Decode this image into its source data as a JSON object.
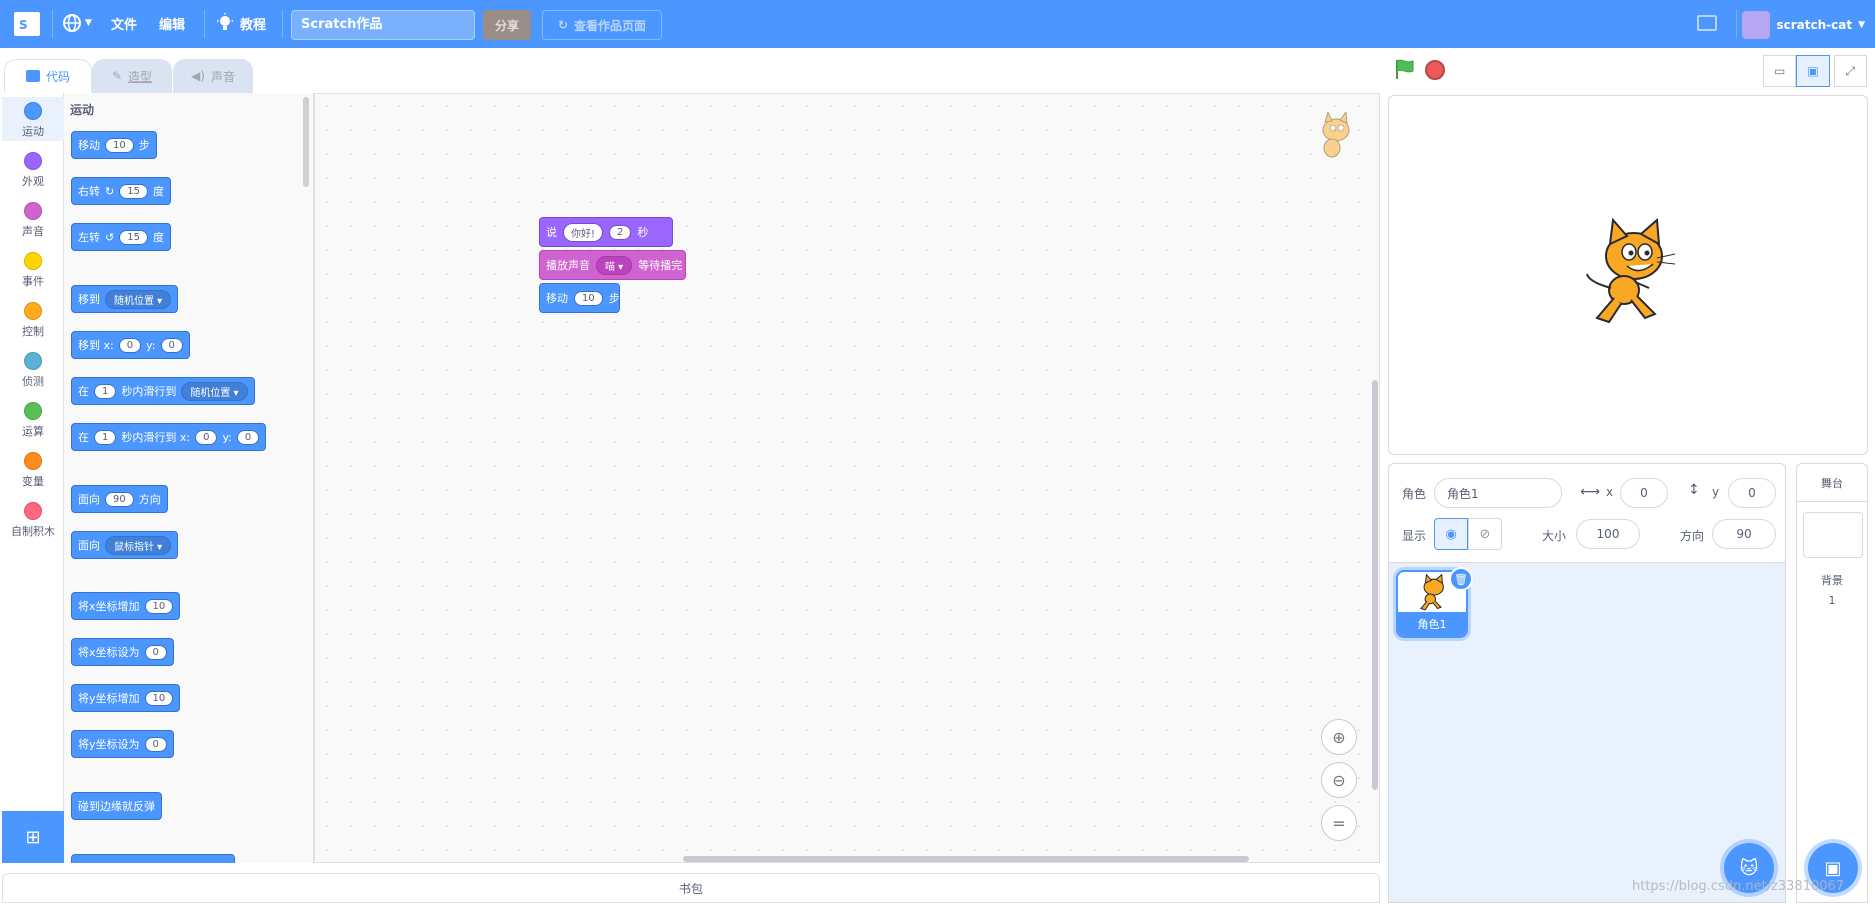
{
  "topbar": {
    "menu_file": "文件",
    "menu_edit": "编辑",
    "tutorials": "教程",
    "project_title": "Scratch作品",
    "share": "分享",
    "see_project_page": "查看作品页面",
    "username": "scratch-cat",
    "logo_icon": "scratch-logo-icon",
    "accent_color": "#4c97ff"
  },
  "tabs": [
    {
      "label": "代码",
      "icon": "code-icon"
    },
    {
      "label": "造型",
      "icon": "brush-icon"
    },
    {
      "label": "声音",
      "icon": "speaker-icon"
    }
  ],
  "categories": [
    {
      "label": "运动",
      "color": "#4c97ff"
    },
    {
      "label": "外观",
      "color": "#9966ff"
    },
    {
      "label": "声音",
      "color": "#cf63cf"
    },
    {
      "label": "事件",
      "color": "#ffd500"
    },
    {
      "label": "控制",
      "color": "#ffab19"
    },
    {
      "label": "侦测",
      "color": "#5cb1d6"
    },
    {
      "label": "运算",
      "color": "#59c059"
    },
    {
      "label": "变量",
      "color": "#ff8c1a"
    },
    {
      "label": "自制积木",
      "color": "#ff6680"
    }
  ],
  "flyout": {
    "title": "运动",
    "move": {
      "a": "移动",
      "v": "10",
      "b": "步"
    },
    "turn_right": {
      "a": "右转",
      "v": "15",
      "b": "度"
    },
    "turn_left": {
      "a": "左转",
      "v": "15",
      "b": "度"
    },
    "goto": {
      "a": "移到",
      "dd": "随机位置"
    },
    "goto_xy": {
      "a": "移到 x:",
      "x": "0",
      "y_label": "y:",
      "y": "0"
    },
    "glide": {
      "a": "在",
      "v": "1",
      "b": "秒内滑行到",
      "dd": "随机位置"
    },
    "glide_xy": {
      "a": "在",
      "v": "1",
      "b": "秒内滑行到 x:",
      "x": "0",
      "y_label": "y:",
      "y": "0"
    },
    "point_dir": {
      "a": "面向",
      "v": "90",
      "b": "方向"
    },
    "point_towards": {
      "a": "面向",
      "dd": "鼠标指针"
    },
    "change_x": {
      "a": "将x坐标增加",
      "v": "10"
    },
    "set_x": {
      "a": "将x坐标设为",
      "v": "0"
    },
    "change_y": {
      "a": "将y坐标增加",
      "v": "10"
    },
    "set_y": {
      "a": "将y坐标设为",
      "v": "0"
    },
    "bounce": {
      "a": "碰到边缘就反弹"
    }
  },
  "script": {
    "say": {
      "a": "说",
      "text": "你好!",
      "secs": "2",
      "b": "秒"
    },
    "play_sound": {
      "a": "播放声音",
      "dd": "喵",
      "b": "等待播完"
    },
    "move": {
      "a": "移动",
      "v": "10",
      "b": "步"
    }
  },
  "backpack": "书包",
  "sprite_info": {
    "sprite_label": "角色",
    "sprite_name": "角色1",
    "x_label": "x",
    "x_value": "0",
    "y_label": "y",
    "y_value": "0",
    "show_label": "显示",
    "size_label": "大小",
    "size_value": "100",
    "direction_label": "方向",
    "direction_value": "90"
  },
  "sprite_list": [
    {
      "name": "角色1"
    }
  ],
  "stage_pane": {
    "title": "舞台",
    "backdrops_label": "背景",
    "backdrops_count": "1"
  },
  "watermark": "https://blog.csdn.net/z33810067"
}
